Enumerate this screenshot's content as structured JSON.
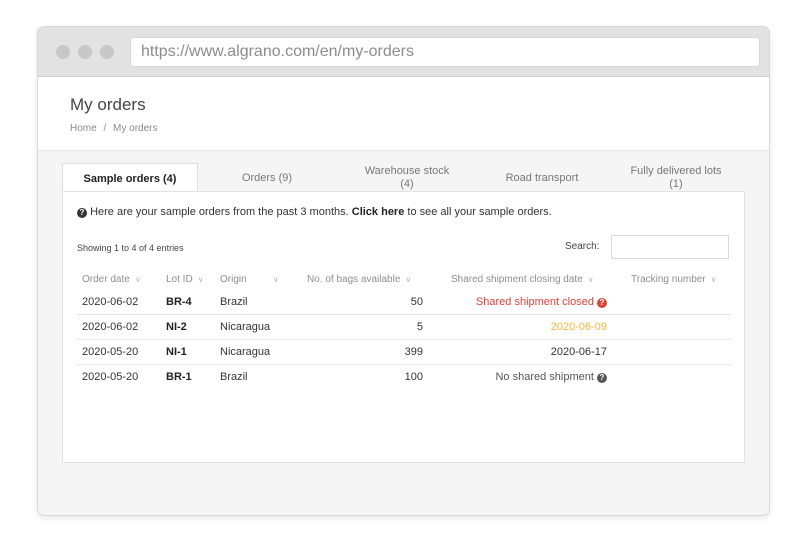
{
  "browser": {
    "url": "https://www.algrano.com/en/my-orders"
  },
  "page": {
    "title": "My orders",
    "breadcrumb": [
      "Home",
      "/",
      "My orders"
    ]
  },
  "tabs": [
    {
      "label": "Sample orders (4)",
      "active": true
    },
    {
      "label": "Orders (9)",
      "active": false
    },
    {
      "label_line1": "Warehouse stock",
      "label_line2": "(4)",
      "active": false
    },
    {
      "label": "Road transport",
      "active": false
    },
    {
      "label_line1": "Fully delivered lots",
      "label_line2": "(1)",
      "active": false
    }
  ],
  "info": {
    "text_before": "Here are your sample orders from the past 3 months.",
    "link_text": "Click here",
    "text_after": "to see all your sample orders."
  },
  "table": {
    "showing": "Showing 1 to 4 of 4 entries",
    "search_label": "Search:",
    "search_value": "",
    "columns": [
      "Order date",
      "Lot ID",
      "Origin",
      "No. of bags available",
      "Shared shipment closing date",
      "Tracking number"
    ],
    "rows": [
      {
        "date": "2020-06-02",
        "lot": "BR-4",
        "origin": "Brazil",
        "bags": "50",
        "shipment": "Shared shipment closed",
        "shipment_style": "red-closed",
        "tracking": ""
      },
      {
        "date": "2020-06-02",
        "lot": "NI-2",
        "origin": "Nicaragua",
        "bags": "5",
        "shipment": "2020-06-09",
        "shipment_style": "orange",
        "tracking": ""
      },
      {
        "date": "2020-05-20",
        "lot": "NI-1",
        "origin": "Nicaragua",
        "bags": "399",
        "shipment": "2020-06-17",
        "shipment_style": "normal",
        "tracking": ""
      },
      {
        "date": "2020-05-20",
        "lot": "BR-1",
        "origin": "Brazil",
        "bags": "100",
        "shipment": "No shared shipment",
        "shipment_style": "grey-info",
        "tracking": ""
      }
    ]
  },
  "colors": {
    "closed_red": "#d9443a",
    "upcoming_orange": "#f0b43c"
  },
  "icons": {
    "info": "question-circle-icon",
    "sort": "chevron-down-icon"
  }
}
